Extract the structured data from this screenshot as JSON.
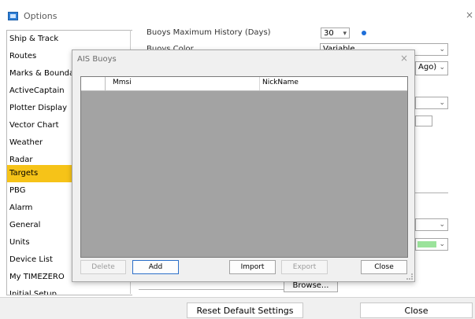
{
  "window": {
    "title": "Options",
    "close_glyph": "×"
  },
  "sidebar": {
    "items": [
      {
        "label": "Ship & Track"
      },
      {
        "label": "Routes"
      },
      {
        "label": "Marks & Boundaries"
      },
      {
        "label": "ActiveCaptain"
      },
      {
        "label": "Plotter Display"
      },
      {
        "label": "Vector Chart"
      },
      {
        "label": "Weather"
      },
      {
        "label": "Radar"
      },
      {
        "label": "Targets"
      },
      {
        "label": "PBG"
      },
      {
        "label": "Alarm"
      },
      {
        "label": "General"
      },
      {
        "label": "Units"
      },
      {
        "label": "Device List"
      },
      {
        "label": "My TIMEZERO"
      },
      {
        "label": "Initial Setup"
      }
    ],
    "active": "Targets"
  },
  "background": {
    "buoys_history_label": "Buoys Maximum History (Days)",
    "buoys_history_value": "30",
    "buoys_color_label": "Buoys Color",
    "buoys_color_value": "Variable",
    "ago_value": "Ago)",
    "browse_label": "Browse...",
    "accent_color": "#1e6fd9",
    "green_swatch": "#9be39b"
  },
  "footer": {
    "reset_label": "Reset Default Settings",
    "close_label": "Close"
  },
  "modal": {
    "title": "AIS Buoys",
    "close_glyph": "×",
    "columns": [
      "Mmsi",
      "NickName"
    ],
    "rows": [],
    "buttons": {
      "delete": "Delete",
      "add": "Add",
      "import": "Import",
      "export": "Export",
      "close": "Close"
    }
  }
}
